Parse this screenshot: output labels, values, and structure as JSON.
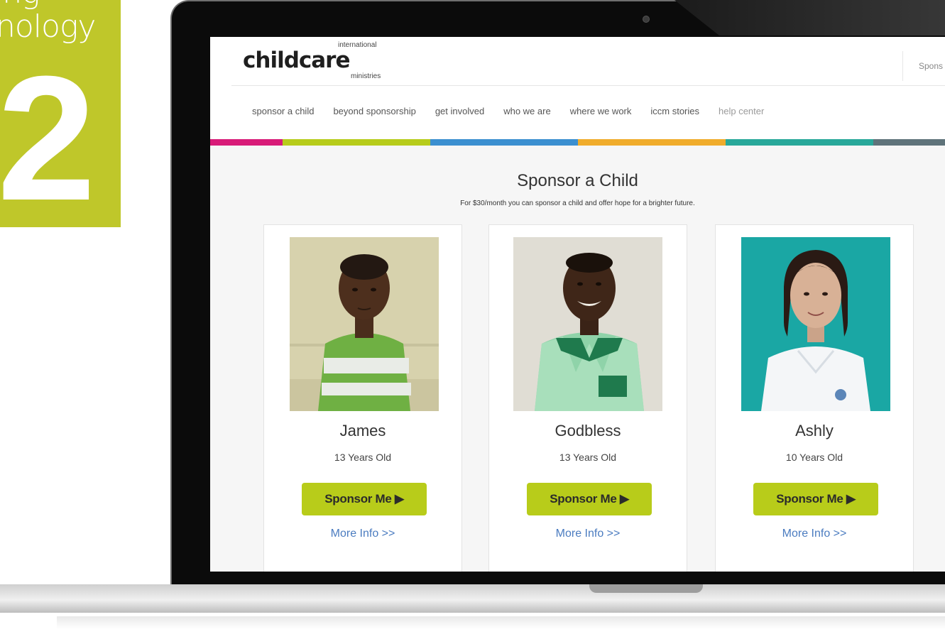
{
  "side": {
    "line1": "ing",
    "line2": "nology",
    "number": "2"
  },
  "site": {
    "logo_main": "childcare",
    "logo_top": "international",
    "logo_bottom": "ministries",
    "header_link": "Spons"
  },
  "nav": [
    {
      "label": "sponsor a child"
    },
    {
      "label": "beyond sponsorship"
    },
    {
      "label": "get involved"
    },
    {
      "label": "who we are"
    },
    {
      "label": "where we work"
    },
    {
      "label": "iccm stories"
    },
    {
      "label": "help center"
    }
  ],
  "colors": {
    "brand_green": "#b8cc1a",
    "panel_green": "#bfc72a",
    "link_blue": "#4b7cc0",
    "bar": [
      "#d81b78",
      "#b7cc1b",
      "#3b8fd0",
      "#f0ac2b",
      "#28a89a",
      "#5f737a"
    ]
  },
  "hero": {
    "title": "Sponsor a Child",
    "subtitle": "For $30/month you can sponsor a child and offer hope for a brighter future."
  },
  "children": [
    {
      "name": "James",
      "age": "13 Years Old",
      "button": "Sponsor Me ▶",
      "link": "More Info >>"
    },
    {
      "name": "Godbless",
      "age": "13 Years Old",
      "button": "Sponsor Me ▶",
      "link": "More Info >>"
    },
    {
      "name": "Ashly",
      "age": "10 Years Old",
      "button": "Sponsor Me ▶",
      "link": "More Info >>"
    }
  ]
}
